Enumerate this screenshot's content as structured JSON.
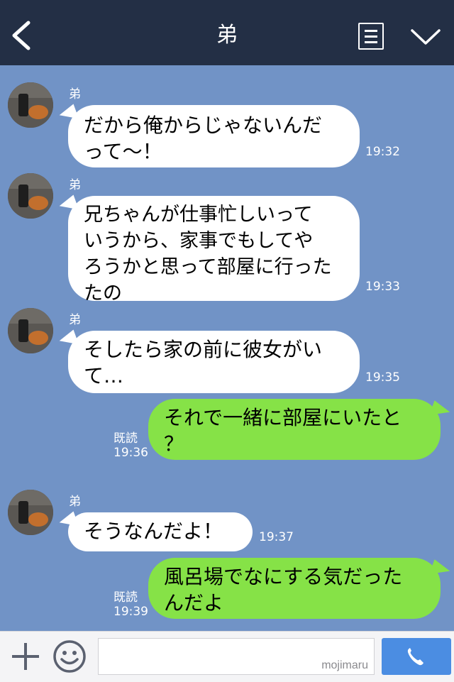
{
  "header": {
    "title": "弟",
    "back_icon": "chevron-left-icon",
    "menu_icon": "list-icon",
    "dropdown_icon": "chevron-down-icon"
  },
  "messages": [
    {
      "side": "in",
      "sender": "弟",
      "lines": [
        "だから俺からじゃないんだ",
        "って〜！"
      ],
      "time": "19:32"
    },
    {
      "side": "in",
      "sender": "弟",
      "lines": [
        "兄ちゃんが仕事忙しいって",
        "いうから、家事でもしてや",
        "ろうかと思って部屋に行った",
        "たの"
      ],
      "time": "19:33"
    },
    {
      "side": "in",
      "sender": "弟",
      "lines": [
        "そしたら家の前に彼女がい",
        "て…"
      ],
      "time": "19:35"
    },
    {
      "side": "out",
      "lines": [
        "それで一緒に部屋にいたと",
        "？"
      ],
      "read": "既読",
      "time": "19:36"
    },
    {
      "side": "in",
      "sender": "弟",
      "lines": [
        "そうなんだよ！"
      ],
      "time": "19:37"
    },
    {
      "side": "out",
      "lines": [
        "風呂場でなにする気だった",
        "んだよ"
      ],
      "read": "既読",
      "time": "19:39"
    }
  ],
  "input": {
    "placeholder": "",
    "watermark": "mojimaru"
  },
  "colors": {
    "header": "#232f45",
    "background": "#7193c6",
    "incoming": "#ffffff",
    "outgoing": "#86e247",
    "call_button": "#4b8de2"
  }
}
